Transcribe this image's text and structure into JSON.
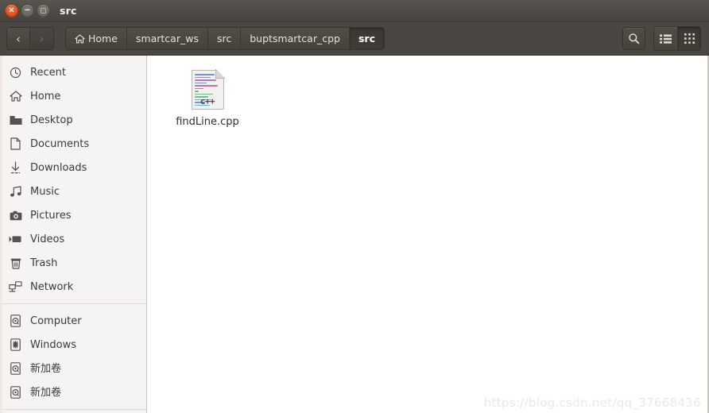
{
  "window": {
    "title": "src",
    "controls": {
      "close": "×",
      "minimize": "−",
      "maximize": "□"
    },
    "colors": {
      "titlebar": "#4e4a45",
      "toolbar": "#4a4642",
      "close_button": "#dd4814",
      "sidebar": "#f5f4f2",
      "content": "#ffffff"
    }
  },
  "toolbar": {
    "back_label": "‹",
    "forward_label": "›",
    "breadcrumbs": [
      {
        "label": "Home",
        "icon": "home-icon",
        "active": false
      },
      {
        "label": "smartcar_ws",
        "icon": "",
        "active": false
      },
      {
        "label": "src",
        "icon": "",
        "active": false
      },
      {
        "label": "buptsmartcar_cpp",
        "icon": "",
        "active": false
      },
      {
        "label": "src",
        "icon": "",
        "active": true
      }
    ],
    "search_icon": "search-icon",
    "list_view_icon": "list-view-icon",
    "grid_view_icon": "grid-view-icon",
    "active_view": "grid"
  },
  "sidebar": {
    "groups": [
      {
        "items": [
          {
            "label": "Recent",
            "icon": "clock-icon"
          },
          {
            "label": "Home",
            "icon": "home-icon"
          },
          {
            "label": "Desktop",
            "icon": "folder-icon"
          },
          {
            "label": "Documents",
            "icon": "document-icon"
          },
          {
            "label": "Downloads",
            "icon": "download-icon"
          },
          {
            "label": "Music",
            "icon": "music-note-icon"
          },
          {
            "label": "Pictures",
            "icon": "camera-icon"
          },
          {
            "label": "Videos",
            "icon": "video-camera-icon"
          },
          {
            "label": "Trash",
            "icon": "trash-icon"
          },
          {
            "label": "Network",
            "icon": "network-icon"
          }
        ]
      },
      {
        "items": [
          {
            "label": "Computer",
            "icon": "drive-icon"
          },
          {
            "label": "Windows",
            "icon": "disk-chip-icon"
          },
          {
            "label": "新加卷",
            "icon": "drive-icon"
          },
          {
            "label": "新加卷",
            "icon": "drive-icon"
          }
        ]
      }
    ]
  },
  "content": {
    "files": [
      {
        "name": "findLine.cpp",
        "icon": "cpp-file-icon",
        "type": "c++"
      }
    ],
    "cpp_icon_label": "c++",
    "code_line_colors": [
      "#7b8fd4",
      "#7b8fd4",
      "#b07bc4",
      "#7b8fd4",
      "#c46fa8",
      "#7b8fd4",
      "#6fbf7b",
      "#6fbf7b",
      "#5fb9c9",
      "#6fbf7b",
      "#7b8fd4",
      "#5fb9c9"
    ]
  },
  "watermark": {
    "text": "https://blog.csdn.net/qq_37668436"
  }
}
